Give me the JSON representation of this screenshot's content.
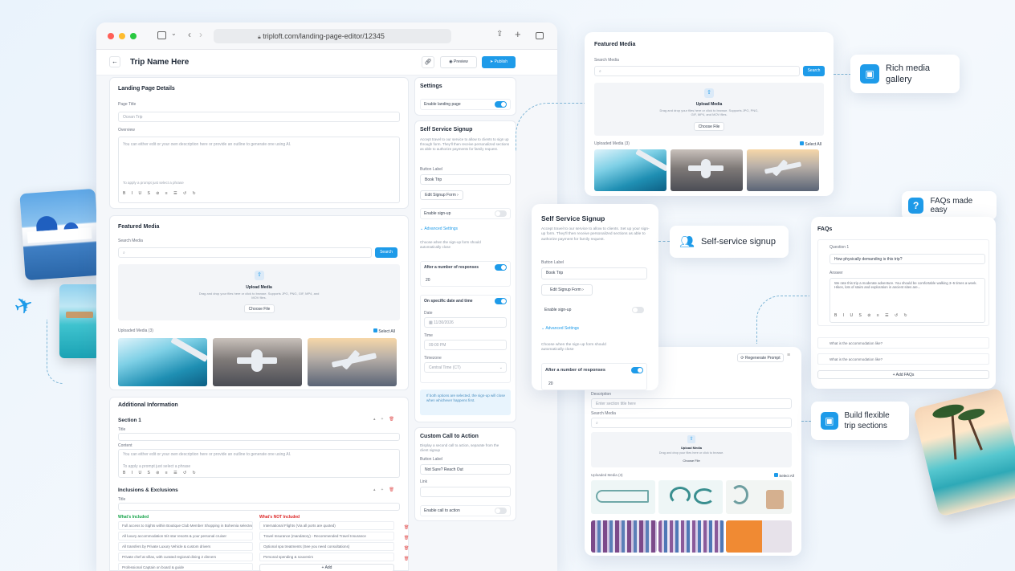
{
  "browser": {
    "url": "triploft.com/landing-page-editor/12345"
  },
  "editor": {
    "title": "Trip Name Here",
    "preview_label": "Preview",
    "publish_label": "Publish",
    "details": {
      "title": "Landing Page Details",
      "page_title_label": "Page Title",
      "page_title_value": "Ocean Trip",
      "overview_label": "Overview",
      "overview_placeholder": "You can either edit or your own description here or provide an outline to generate one using AI.",
      "ai_hint": "To apply a prompt just select a phrase"
    },
    "media": {
      "title": "Featured Media",
      "search_label": "Search Media",
      "search_button": "Search",
      "upload_title": "Upload Media",
      "upload_hint": "Drag and drop your files here or click to browse. Supports JPG, PNG, GIF, MP4, and MOV files.",
      "choose_file": "Choose File",
      "uploaded_label": "Uploaded Media (3)",
      "select_all": "Select All"
    },
    "additional": {
      "title": "Additional Information",
      "section_title": "Section 1",
      "title_label": "Title",
      "content_label": "Content",
      "content_placeholder": "You can either edit or your own description here or provide an outline to generate one using AI.",
      "ai_hint": "To apply a prompt just select a phrase"
    },
    "inclusions": {
      "title": "Inclusions & Exclusions",
      "title_label": "Title",
      "included_label": "What's Included",
      "not_included_label": "What's NOT Included",
      "included": [
        "Full access to Sights within Boutique Club Member Shopping in Bohemia selected...",
        "All luxury accommodation 5/4 star resorts & your personal cruiser",
        "All transfers by Private Luxury Vehicle & custom drivers",
        "Private chef at villas, with curated regional dining 2 dinners",
        "Professional Captain on board & guide"
      ],
      "not_included": [
        "International Flights (Via all ports are quoted)",
        "Travel Insurance (mandatory) - Recommended Travel Insurance",
        "Optional spa treatments (See you need consultations)",
        "Personal spending & souvenirs"
      ],
      "add_label": "+ Add"
    },
    "settings": {
      "title": "Settings",
      "enable_label": "Enable landing page"
    },
    "signup": {
      "title": "Self Service Signup",
      "description": "Accept travel to our service to allow to clients to sign up through form. They'll then receive personalized sections as able to authorize payments for family request.",
      "button_label_label": "Button Label",
      "button_label_value": "Book Trip",
      "edit_form": "Edit Signup Form",
      "enable_signup": "Enable sign-up",
      "advanced": "Advanced Settings",
      "advanced_hint": "Choose when the sign-up form should automatically close",
      "after_responses": "After a number of responses",
      "responses_value": "20",
      "on_date": "On specific date and time",
      "date_label": "Date",
      "date_value": "11/30/2026",
      "time_label": "Time",
      "time_value": "09:00 PM",
      "timezone_label": "Timezone",
      "timezone_value": "Central Time (CT)",
      "notice": "If both options are selected, the sign-up will close when whichever happens first."
    },
    "cta": {
      "title": "Custom Call to Action",
      "description": "Display a second call to action, separate from the client signup",
      "button_label_label": "Button Label",
      "button_label_value": "Not Sure? Reach Out",
      "link_label": "Link",
      "enable_label": "Enable call to action"
    }
  },
  "callouts": {
    "media_card": {
      "title": "Featured Media",
      "search_label": "Search Media",
      "search_button": "Search",
      "upload_title": "Upload Media",
      "upload_hint": "Drag and drop your files here or click to browse. Supports JPG, PNG, GIF, MP4, and MOV files.",
      "choose_file": "Choose File",
      "uploaded_label": "Uploaded Media (3)",
      "select_all": "Select All"
    },
    "signup_card": {
      "title": "Self Service Signup",
      "description": "Accept travel to our service to allow to clients. Set up your sign-up form. They'll then receive personalized sections as able to authorize payment for family request.",
      "button_label_label": "Button Label",
      "button_label_value": "Book Trip",
      "edit_form": "Edit Signup Form",
      "enable_signup": "Enable sign-up",
      "advanced": "Advanced Settings",
      "advanced_hint": "Choose when the sign-up form should automatically close",
      "after_responses": "After a number of responses",
      "responses_value": "20"
    },
    "faq_card": {
      "title": "FAQs",
      "q1_label": "Question 1",
      "q1_value": "How physically demanding is this trip?",
      "answer_label": "Answer",
      "answer_value": "We rate this trip a moderate adventure. You should be comfortable walking 3–5 times a week. Hikes, lots of stairs and exploration in ancient sites are...",
      "q2": "What is the accommodation like?",
      "q3": "What is the accommodation like?",
      "add_label": "+ Add FAQs"
    },
    "sections_card": {
      "regen": "Regenerate Prompt",
      "title_label": "Description",
      "title_placeholder": "Enter section title here",
      "search_label": "Search Media",
      "upload_title": "Upload Media",
      "upload_hint": "Drag and drop your files here or click to browse.",
      "choose_file": "Choose File",
      "uploaded_label": "Uploaded Media (3)",
      "select_all": "Select All"
    },
    "tags": {
      "rich_media": "Rich media gallery",
      "faqs": "FAQs made easy",
      "self_service": "Self-service signup",
      "flexible": "Build flexible trip sections"
    }
  },
  "colors": {
    "accent": "#1e9be9",
    "included": "#16a34a",
    "not_included": "#dc2626"
  }
}
